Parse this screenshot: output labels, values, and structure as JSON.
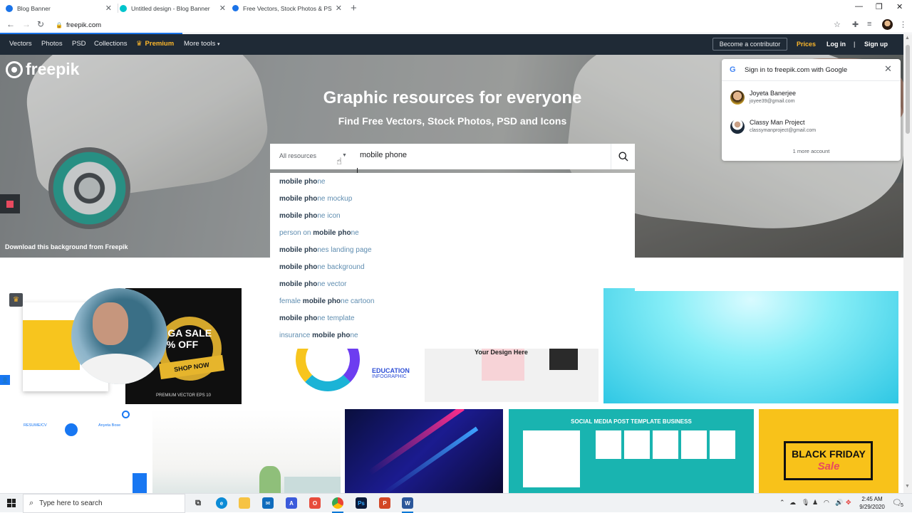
{
  "browser": {
    "tabs": [
      {
        "title": "Blog Banner",
        "favicon_color": "#1a73e8"
      },
      {
        "title": "Untitled design - Blog Banner",
        "favicon_color": "#00c4cc"
      },
      {
        "title": "Free Vectors, Stock Photos & PS",
        "favicon_color": "#1a73e8"
      }
    ],
    "active_tab": 2,
    "url": "freepik.com",
    "new_tab_icon": "plus-icon"
  },
  "nav": {
    "items": [
      "Vectors",
      "Photos",
      "PSD",
      "Collections"
    ],
    "premium": "Premium",
    "more_tools": "More tools",
    "contributor": "Become a contributor",
    "prices": "Prices",
    "login": "Log in",
    "separator": "|",
    "signup": "Sign up"
  },
  "hero": {
    "logo": "freepik",
    "title": "Graphic resources for everyone",
    "subtitle": "Find Free Vectors, Stock Photos, PSD and Icons",
    "credit": "Download this background from Freepik"
  },
  "search": {
    "category": "All resources",
    "query": "mobile phone",
    "suggestions": [
      {
        "pre": "",
        "bold": "mobile pho",
        "post": "ne"
      },
      {
        "pre": "",
        "bold": "mobile pho",
        "post": "ne mockup"
      },
      {
        "pre": "",
        "bold": "mobile pho",
        "post": "ne icon"
      },
      {
        "pre": "person on ",
        "bold": "mobile pho",
        "post": "ne"
      },
      {
        "pre": "",
        "bold": "mobile pho",
        "post": "nes landing page"
      },
      {
        "pre": "",
        "bold": "mobile pho",
        "post": "ne background"
      },
      {
        "pre": "",
        "bold": "mobile pho",
        "post": "ne vector"
      },
      {
        "pre": "female ",
        "bold": "mobile pho",
        "post": "ne cartoon"
      },
      {
        "pre": "",
        "bold": "mobile pho",
        "post": "ne template"
      },
      {
        "pre": "insurance ",
        "bold": "mobile pho",
        "post": "ne"
      }
    ]
  },
  "google_signin": {
    "title": "Sign in to freepik.com with Google",
    "accounts": [
      {
        "name": "Joyeta Banerjee",
        "email": "joyee39@gmail.com"
      },
      {
        "name": "Classy Man Project",
        "email": "classymanproject@gmail.com"
      }
    ],
    "more": "1 more account"
  },
  "gallery": {
    "mega_sale": "EGA SALE",
    "mega_off": "0% OFF",
    "shop_now": "SHOP NOW",
    "premium_vector": "PREMIUM VECTOR EPS 10",
    "education": "EDUCATION",
    "infographic": "INFOGRAPHIC",
    "design_here": "Your Design Here",
    "resume": "RESUME/CV",
    "resume_name": "Anyeta Bose",
    "social_header": "SOCIAL MEDIA POST TEMPLATE BUSINESS",
    "black_friday": "BLACK FRIDAY",
    "sale": "Sale"
  },
  "taskbar": {
    "search_placeholder": "Type here to search",
    "time": "2:45 AM",
    "date": "9/29/2020",
    "notification_count": "5"
  }
}
